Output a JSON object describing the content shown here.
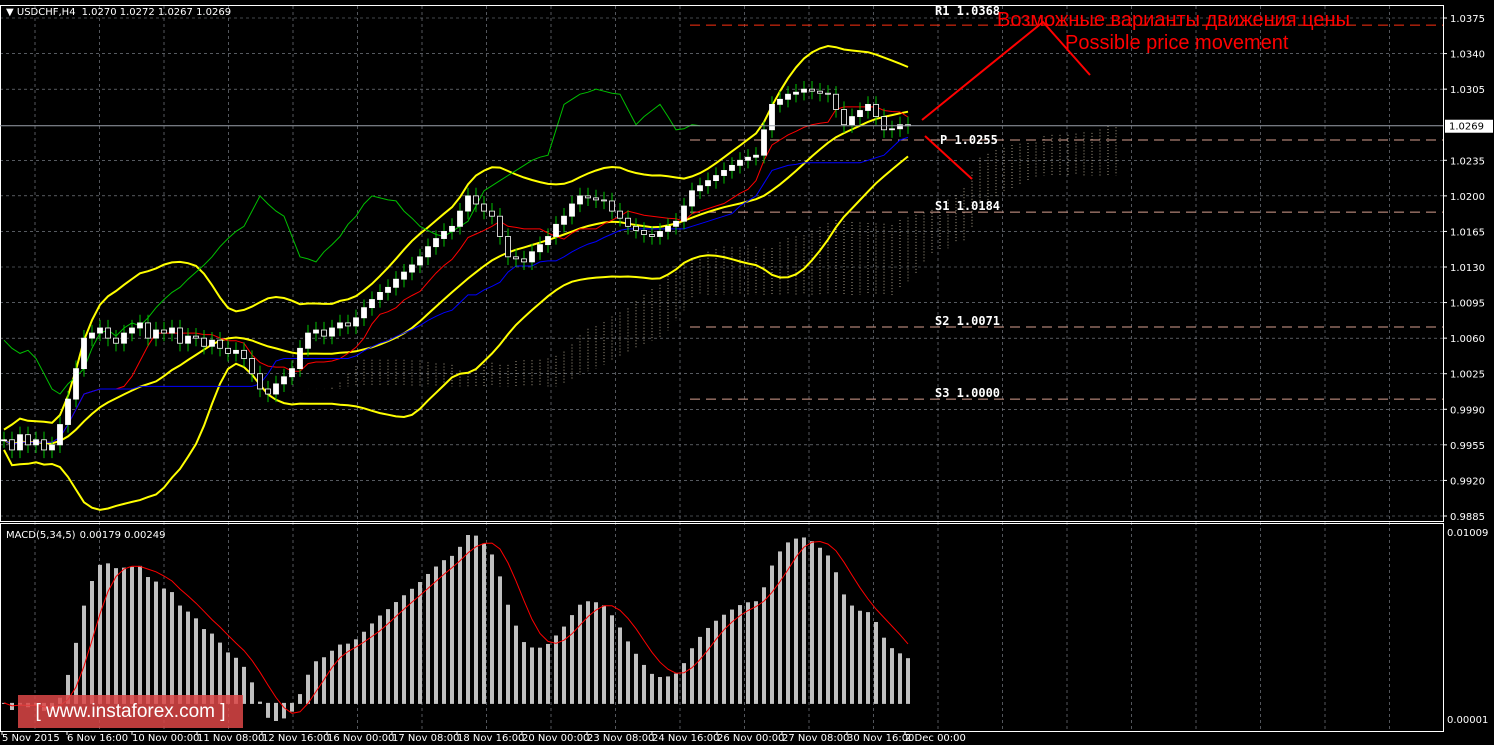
{
  "header": {
    "symbol": "USDCHF,H4",
    "ohlc": "1.0270 1.0272 1.0267 1.0269"
  },
  "macd_header": {
    "label": "MACD(5,34,5)",
    "values": "0.00179 0.00249"
  },
  "annotation": {
    "ru": "Возможные варианты движения цены",
    "en": "Possible price movement"
  },
  "watermark": "[ www.instaforex.com ]",
  "current_price": "1.0269",
  "colors": {
    "bg": "#000000",
    "grid": "#8a8f99",
    "bollinger": "#ffff00",
    "tenkan": "#ff0000",
    "kijun": "#0000ff",
    "chikou": "#00c000",
    "cloud": "#f0e0c0",
    "pivot": "#ff6a3a",
    "macd_hist": "#c0c0c0",
    "macd_signal": "#ff0000",
    "annotation": "#ff0000"
  },
  "chart_data": {
    "type": "candlestick",
    "title": "USDCHF,H4",
    "timeframe": "H4",
    "x_tick_labels": [
      "5 Nov 2015",
      "6 Nov 16:00",
      "10 Nov 00:00",
      "11 Nov 08:00",
      "12 Nov 16:00",
      "16 Nov 00:00",
      "17 Nov 08:00",
      "18 Nov 16:00",
      "20 Nov 00:00",
      "23 Nov 08:00",
      "24 Nov 16:00",
      "26 Nov 00:00",
      "27 Nov 08:00",
      "30 Nov 16:00",
      "2 Dec 00:00"
    ],
    "y_tick_labels": [
      "1.0375",
      "1.0340",
      "1.0305",
      "1.0235",
      "1.0200",
      "1.0165",
      "1.0130",
      "1.0095",
      "1.0060",
      "1.0025",
      "0.9990",
      "0.9955",
      "0.9920",
      "0.9885"
    ],
    "ylim": [
      0.9885,
      1.0375
    ],
    "close": [
      0.996,
      0.995,
      0.9965,
      0.9955,
      0.996,
      0.995,
      0.9955,
      0.9975,
      1.0,
      1.003,
      1.006,
      1.0065,
      1.007,
      1.006,
      1.0055,
      1.0065,
      1.007,
      1.0075,
      1.006,
      1.0068,
      1.0065,
      1.007,
      1.0055,
      1.0062,
      1.006,
      1.0052,
      1.0058,
      1.005,
      1.0045,
      1.0048,
      1.004,
      1.0025,
      1.001,
      1.0005,
      1.0015,
      1.0022,
      1.003,
      1.005,
      1.0065,
      1.0068,
      1.0062,
      1.007,
      1.0075,
      1.0072,
      1.008,
      1.009,
      1.0098,
      1.0105,
      1.011,
      1.0118,
      1.0125,
      1.0132,
      1.014,
      1.015,
      1.0158,
      1.0165,
      1.017,
      1.0185,
      1.02,
      1.0192,
      1.0185,
      1.018,
      1.016,
      1.014,
      1.0138,
      1.0135,
      1.0145,
      1.0152,
      1.016,
      1.0172,
      1.018,
      1.0192,
      1.02,
      1.0198,
      1.0196,
      1.0195,
      1.0185,
      1.0178,
      1.017,
      1.0166,
      1.0162,
      1.016,
      1.0165,
      1.017,
      1.0175,
      1.019,
      1.0205,
      1.021,
      1.0215,
      1.022,
      1.0225,
      1.023,
      1.0235,
      1.0238,
      1.024,
      1.0265,
      1.029,
      1.0295,
      1.03,
      1.0302,
      1.0305,
      1.0303,
      1.0301,
      1.03,
      1.0285,
      1.027,
      1.0278,
      1.0284,
      1.029,
      1.0278,
      1.0265,
      1.0266,
      1.027,
      1.0269
    ],
    "indicators": {
      "bollinger": {
        "period": 20,
        "deviation": 2
      },
      "ichimoku": {
        "tenkan": 9,
        "kijun": 26,
        "senkou_b": 52
      },
      "macd": {
        "fast": 5,
        "slow": 34,
        "signal": 5
      }
    },
    "pivots": [
      {
        "name": "R1",
        "value": "1.0368"
      },
      {
        "name": "P",
        "value": "1.0255"
      },
      {
        "name": "S1",
        "value": "1.0184"
      },
      {
        "name": "S2",
        "value": "1.0071"
      },
      {
        "name": "S3",
        "value": "1.0000"
      }
    ],
    "macd_ylim": [
      "0.00001",
      "0.01009"
    ],
    "macd_last": {
      "main": 0.00179,
      "signal": 0.00249
    }
  }
}
